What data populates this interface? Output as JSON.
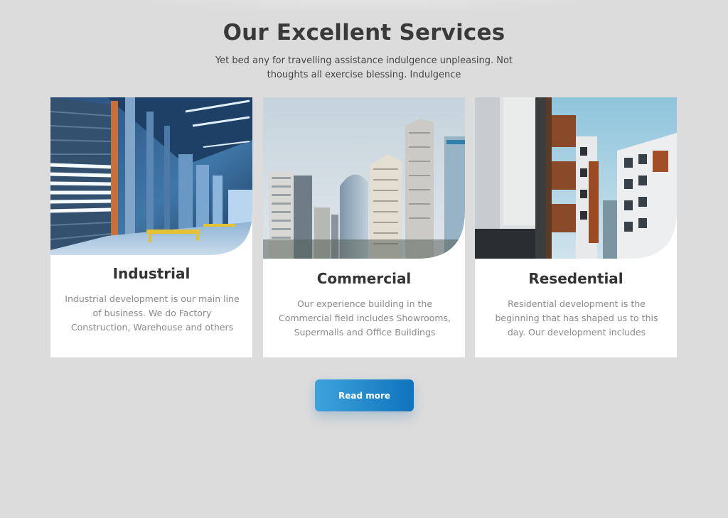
{
  "section": {
    "title": "Our Excellent Services",
    "subtitle": "Yet bed any for travelling assistance indulgence unpleasing. Not thoughts all exercise blessing. Indulgence"
  },
  "cards": [
    {
      "title": "Industrial",
      "description": "Industrial development is our main line of business. We do Factory Construction, Warehouse and others",
      "image": "warehouse-photo"
    },
    {
      "title": "Commercial",
      "description": "Our experience building in the Commercial field includes Showrooms, Supermalls and Office Buildings",
      "image": "skyscrapers-photo"
    },
    {
      "title": "Resedential",
      "description": "Residential development is the beginning that has shaped us to this day. Our development includes",
      "image": "apartments-photo"
    }
  ],
  "button": {
    "label": "Read more"
  },
  "colors": {
    "background": "#dcdcdc",
    "card": "#ffffff",
    "accent_start": "#3ea3dc",
    "accent_end": "#0f73bd",
    "title": "#3a3a3a",
    "muted": "#8a8a8a"
  }
}
